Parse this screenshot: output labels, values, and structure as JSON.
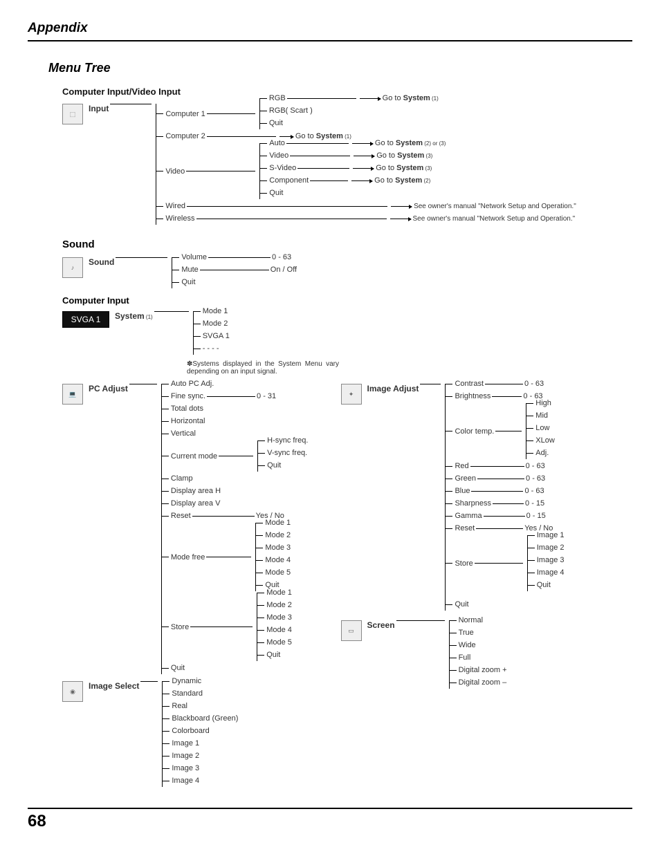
{
  "doc": {
    "header": "Appendix",
    "title": "Menu Tree",
    "page_number": "68"
  },
  "input_section": {
    "heading": "Computer Input/Video Input",
    "root": "Input",
    "computer1": {
      "label": "Computer 1",
      "rgb": "RGB",
      "rgb_goto": "Go to ",
      "rgb_goto_b": "System",
      "rgb_goto_s": " (1)",
      "rgb_scart": "RGB( Scart )",
      "quit": "Quit"
    },
    "computer2": {
      "label": "Computer 2",
      "goto": "Go to ",
      "goto_b": "System",
      "goto_s": " (1)"
    },
    "video": {
      "label": "Video",
      "auto": "Auto",
      "auto_goto": "Go to ",
      "auto_goto_b": "System",
      "auto_goto_s": " (2) or (3)",
      "video_item": "Video",
      "video_goto": "Go to ",
      "video_goto_b": "System",
      "video_goto_s": " (3)",
      "svideo": "S-Video",
      "svideo_goto": "Go to ",
      "svideo_goto_b": "System",
      "svideo_goto_s": " (3)",
      "component": "Component",
      "component_goto": "Go to ",
      "component_goto_b": "System",
      "component_goto_s": " (2)",
      "quit": "Quit"
    },
    "wired": {
      "label": "Wired",
      "note": "See owner's manual \"Network Setup and Operation.\""
    },
    "wireless": {
      "label": "Wireless",
      "note": "See owner's manual \"Network Setup and Operation.\""
    }
  },
  "sound_section": {
    "heading": "Sound",
    "root": "Sound",
    "volume": {
      "label": "Volume",
      "range": "0 - 63"
    },
    "mute": {
      "label": "Mute",
      "range": "On / Off"
    },
    "quit": "Quit"
  },
  "system_section": {
    "heading": "Computer Input",
    "badge": "SVGA 1",
    "root": "System",
    "root_s": " (1)",
    "items": [
      "Mode 1",
      "Mode 2",
      "SVGA 1",
      "- - - -"
    ],
    "note": "✽Systems displayed in the System Menu vary depending on an input signal."
  },
  "pc_adjust": {
    "root": "PC Adjust",
    "items1": [
      "Auto PC Adj."
    ],
    "fine_sync": {
      "label": "Fine sync.",
      "range": "0 - 31"
    },
    "items2": [
      "Total dots",
      "Horizontal",
      "Vertical"
    ],
    "current_mode": {
      "label": "Current mode",
      "sub": [
        "H-sync freq.",
        "V-sync freq.",
        "Quit"
      ]
    },
    "clamp": "Clamp",
    "items3": [
      "Display area H",
      "Display area V"
    ],
    "reset": {
      "label": "Reset",
      "val": "Yes / No"
    },
    "mode_free": {
      "label": "Mode free",
      "sub": [
        "Mode 1",
        "Mode 2",
        "Mode 3",
        "Mode 4",
        "Mode 5",
        "Quit"
      ]
    },
    "store": {
      "label": "Store",
      "sub": [
        "Mode 1",
        "Mode 2",
        "Mode 3",
        "Mode 4",
        "Mode 5",
        "Quit"
      ]
    },
    "quit": "Quit"
  },
  "image_select": {
    "root": "Image Select",
    "items": [
      "Dynamic",
      "Standard",
      "Real",
      "Blackboard (Green)",
      "Colorboard",
      "Image 1",
      "Image 2",
      "Image 3",
      "Image 4"
    ]
  },
  "image_adjust": {
    "root": "Image Adjust",
    "contrast": {
      "label": "Contrast",
      "range": "0 - 63"
    },
    "brightness": {
      "label": "Brightness",
      "range": "0 - 63"
    },
    "color_temp": {
      "label": "Color temp.",
      "sub": [
        "High",
        "Mid",
        "Low",
        "XLow",
        "Adj."
      ]
    },
    "red": {
      "label": "Red",
      "range": "0 - 63"
    },
    "green": {
      "label": "Green",
      "range": "0 - 63"
    },
    "blue": {
      "label": "Blue",
      "range": "0 - 63"
    },
    "sharpness": {
      "label": "Sharpness",
      "range": "0 - 15"
    },
    "gamma": {
      "label": "Gamma",
      "range": "0 - 15"
    },
    "reset": {
      "label": "Reset",
      "val": "Yes / No"
    },
    "store": {
      "label": "Store",
      "sub": [
        "Image 1",
        "Image 2",
        "Image 3",
        "Image 4",
        "Quit"
      ]
    },
    "quit": "Quit"
  },
  "screen": {
    "root": "Screen",
    "items": [
      "Normal",
      "True",
      "Wide",
      "Full",
      "Digital zoom +",
      "Digital zoom –"
    ]
  }
}
